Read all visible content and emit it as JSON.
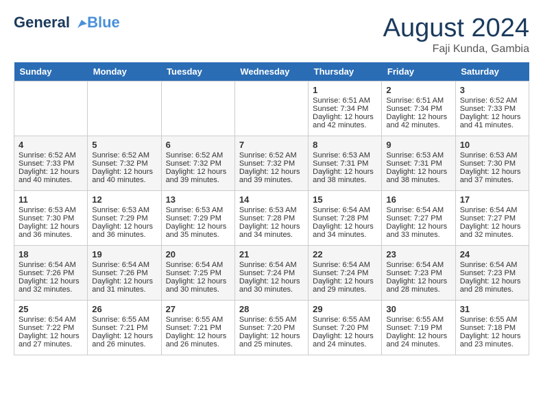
{
  "header": {
    "logo_line1": "General",
    "logo_line2": "Blue",
    "month_year": "August 2024",
    "location": "Faji Kunda, Gambia"
  },
  "weekdays": [
    "Sunday",
    "Monday",
    "Tuesday",
    "Wednesday",
    "Thursday",
    "Friday",
    "Saturday"
  ],
  "weeks": [
    [
      {
        "day": "",
        "sunrise": "",
        "sunset": "",
        "daylight": ""
      },
      {
        "day": "",
        "sunrise": "",
        "sunset": "",
        "daylight": ""
      },
      {
        "day": "",
        "sunrise": "",
        "sunset": "",
        "daylight": ""
      },
      {
        "day": "",
        "sunrise": "",
        "sunset": "",
        "daylight": ""
      },
      {
        "day": "1",
        "sunrise": "Sunrise: 6:51 AM",
        "sunset": "Sunset: 7:34 PM",
        "daylight": "Daylight: 12 hours and 42 minutes."
      },
      {
        "day": "2",
        "sunrise": "Sunrise: 6:51 AM",
        "sunset": "Sunset: 7:34 PM",
        "daylight": "Daylight: 12 hours and 42 minutes."
      },
      {
        "day": "3",
        "sunrise": "Sunrise: 6:52 AM",
        "sunset": "Sunset: 7:33 PM",
        "daylight": "Daylight: 12 hours and 41 minutes."
      }
    ],
    [
      {
        "day": "4",
        "sunrise": "Sunrise: 6:52 AM",
        "sunset": "Sunset: 7:33 PM",
        "daylight": "Daylight: 12 hours and 40 minutes."
      },
      {
        "day": "5",
        "sunrise": "Sunrise: 6:52 AM",
        "sunset": "Sunset: 7:32 PM",
        "daylight": "Daylight: 12 hours and 40 minutes."
      },
      {
        "day": "6",
        "sunrise": "Sunrise: 6:52 AM",
        "sunset": "Sunset: 7:32 PM",
        "daylight": "Daylight: 12 hours and 39 minutes."
      },
      {
        "day": "7",
        "sunrise": "Sunrise: 6:52 AM",
        "sunset": "Sunset: 7:32 PM",
        "daylight": "Daylight: 12 hours and 39 minutes."
      },
      {
        "day": "8",
        "sunrise": "Sunrise: 6:53 AM",
        "sunset": "Sunset: 7:31 PM",
        "daylight": "Daylight: 12 hours and 38 minutes."
      },
      {
        "day": "9",
        "sunrise": "Sunrise: 6:53 AM",
        "sunset": "Sunset: 7:31 PM",
        "daylight": "Daylight: 12 hours and 38 minutes."
      },
      {
        "day": "10",
        "sunrise": "Sunrise: 6:53 AM",
        "sunset": "Sunset: 7:30 PM",
        "daylight": "Daylight: 12 hours and 37 minutes."
      }
    ],
    [
      {
        "day": "11",
        "sunrise": "Sunrise: 6:53 AM",
        "sunset": "Sunset: 7:30 PM",
        "daylight": "Daylight: 12 hours and 36 minutes."
      },
      {
        "day": "12",
        "sunrise": "Sunrise: 6:53 AM",
        "sunset": "Sunset: 7:29 PM",
        "daylight": "Daylight: 12 hours and 36 minutes."
      },
      {
        "day": "13",
        "sunrise": "Sunrise: 6:53 AM",
        "sunset": "Sunset: 7:29 PM",
        "daylight": "Daylight: 12 hours and 35 minutes."
      },
      {
        "day": "14",
        "sunrise": "Sunrise: 6:53 AM",
        "sunset": "Sunset: 7:28 PM",
        "daylight": "Daylight: 12 hours and 34 minutes."
      },
      {
        "day": "15",
        "sunrise": "Sunrise: 6:54 AM",
        "sunset": "Sunset: 7:28 PM",
        "daylight": "Daylight: 12 hours and 34 minutes."
      },
      {
        "day": "16",
        "sunrise": "Sunrise: 6:54 AM",
        "sunset": "Sunset: 7:27 PM",
        "daylight": "Daylight: 12 hours and 33 minutes."
      },
      {
        "day": "17",
        "sunrise": "Sunrise: 6:54 AM",
        "sunset": "Sunset: 7:27 PM",
        "daylight": "Daylight: 12 hours and 32 minutes."
      }
    ],
    [
      {
        "day": "18",
        "sunrise": "Sunrise: 6:54 AM",
        "sunset": "Sunset: 7:26 PM",
        "daylight": "Daylight: 12 hours and 32 minutes."
      },
      {
        "day": "19",
        "sunrise": "Sunrise: 6:54 AM",
        "sunset": "Sunset: 7:26 PM",
        "daylight": "Daylight: 12 hours and 31 minutes."
      },
      {
        "day": "20",
        "sunrise": "Sunrise: 6:54 AM",
        "sunset": "Sunset: 7:25 PM",
        "daylight": "Daylight: 12 hours and 30 minutes."
      },
      {
        "day": "21",
        "sunrise": "Sunrise: 6:54 AM",
        "sunset": "Sunset: 7:24 PM",
        "daylight": "Daylight: 12 hours and 30 minutes."
      },
      {
        "day": "22",
        "sunrise": "Sunrise: 6:54 AM",
        "sunset": "Sunset: 7:24 PM",
        "daylight": "Daylight: 12 hours and 29 minutes."
      },
      {
        "day": "23",
        "sunrise": "Sunrise: 6:54 AM",
        "sunset": "Sunset: 7:23 PM",
        "daylight": "Daylight: 12 hours and 28 minutes."
      },
      {
        "day": "24",
        "sunrise": "Sunrise: 6:54 AM",
        "sunset": "Sunset: 7:23 PM",
        "daylight": "Daylight: 12 hours and 28 minutes."
      }
    ],
    [
      {
        "day": "25",
        "sunrise": "Sunrise: 6:54 AM",
        "sunset": "Sunset: 7:22 PM",
        "daylight": "Daylight: 12 hours and 27 minutes."
      },
      {
        "day": "26",
        "sunrise": "Sunrise: 6:55 AM",
        "sunset": "Sunset: 7:21 PM",
        "daylight": "Daylight: 12 hours and 26 minutes."
      },
      {
        "day": "27",
        "sunrise": "Sunrise: 6:55 AM",
        "sunset": "Sunset: 7:21 PM",
        "daylight": "Daylight: 12 hours and 26 minutes."
      },
      {
        "day": "28",
        "sunrise": "Sunrise: 6:55 AM",
        "sunset": "Sunset: 7:20 PM",
        "daylight": "Daylight: 12 hours and 25 minutes."
      },
      {
        "day": "29",
        "sunrise": "Sunrise: 6:55 AM",
        "sunset": "Sunset: 7:20 PM",
        "daylight": "Daylight: 12 hours and 24 minutes."
      },
      {
        "day": "30",
        "sunrise": "Sunrise: 6:55 AM",
        "sunset": "Sunset: 7:19 PM",
        "daylight": "Daylight: 12 hours and 24 minutes."
      },
      {
        "day": "31",
        "sunrise": "Sunrise: 6:55 AM",
        "sunset": "Sunset: 7:18 PM",
        "daylight": "Daylight: 12 hours and 23 minutes."
      }
    ]
  ]
}
